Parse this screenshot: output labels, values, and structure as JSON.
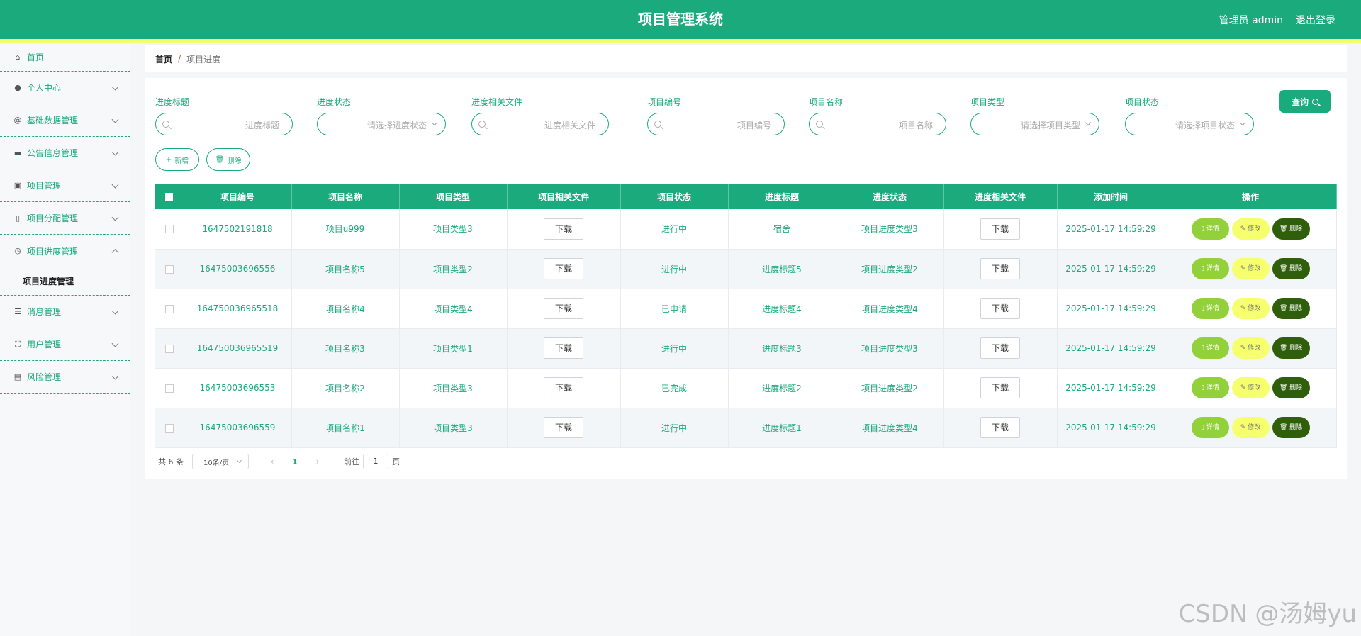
{
  "header": {
    "title": "项目管理系统",
    "user": "管理员 admin",
    "logout": "退出登录",
    "color": "#1baa7c",
    "stripe_color": "#f4ff6b"
  },
  "sidebar": {
    "items": [
      {
        "label": "首页",
        "icon": "home-icon"
      },
      {
        "label": "个人中心",
        "icon": "user-icon"
      },
      {
        "label": "基础数据管理",
        "icon": "at-icon"
      },
      {
        "label": "公告信息管理",
        "icon": "board-icon"
      },
      {
        "label": "项目管理",
        "icon": "briefcase-icon"
      },
      {
        "label": "项目分配管理",
        "icon": "mic-icon"
      },
      {
        "label": "项目进度管理",
        "icon": "clock-icon"
      },
      {
        "label": "消息管理",
        "icon": "list-icon"
      },
      {
        "label": "用户管理",
        "icon": "frame-icon"
      },
      {
        "label": "风险管理",
        "icon": "clipboard-icon"
      }
    ],
    "subitem": "项目进度管理"
  },
  "breadcrumb": {
    "home": "首页",
    "sep": "/",
    "current": "项目进度"
  },
  "filters": [
    {
      "label": "进度标题",
      "placeholder": "进度标题"
    },
    {
      "label": "进度状态",
      "placeholder": "请选择进度状态"
    },
    {
      "label": "进度相关文件",
      "placeholder": "进度相关文件"
    },
    {
      "label": "项目编号",
      "placeholder": "项目编号"
    },
    {
      "label": "项目名称",
      "placeholder": "项目名称"
    },
    {
      "label": "项目类型",
      "placeholder": "请选择项目类型"
    },
    {
      "label": "项目状态",
      "placeholder": "请选择项目状态"
    }
  ],
  "actions": {
    "query": "查询",
    "add": "新增",
    "delete": "删除"
  },
  "table": {
    "headers": [
      "项目编号",
      "项目名称",
      "项目类型",
      "项目相关文件",
      "项目状态",
      "进度标题",
      "进度状态",
      "进度相关文件",
      "添加时间",
      "操作"
    ],
    "download_label": "下载",
    "op_labels": {
      "detail": "详情",
      "edit": "修改",
      "del": "删除"
    },
    "rows": [
      {
        "no": "1647502191818",
        "name": "项目u999",
        "type": "项目类型3",
        "status": "进行中",
        "ptitle": "宿舍",
        "pstatus": "项目进度类型3",
        "time": "2025-01-17 14:59:29"
      },
      {
        "no": "16475003696556",
        "name": "项目名称5",
        "type": "项目类型2",
        "status": "进行中",
        "ptitle": "进度标题5",
        "pstatus": "项目进度类型2",
        "time": "2025-01-17 14:59:29"
      },
      {
        "no": "164750036965518",
        "name": "项目名称4",
        "type": "项目类型4",
        "status": "已申请",
        "ptitle": "进度标题4",
        "pstatus": "项目进度类型4",
        "time": "2025-01-17 14:59:29"
      },
      {
        "no": "164750036965519",
        "name": "项目名称3",
        "type": "项目类型1",
        "status": "进行中",
        "ptitle": "进度标题3",
        "pstatus": "项目进度类型3",
        "time": "2025-01-17 14:59:29"
      },
      {
        "no": "16475003696553",
        "name": "项目名称2",
        "type": "项目类型3",
        "status": "已完成",
        "ptitle": "进度标题2",
        "pstatus": "项目进度类型2",
        "time": "2025-01-17 14:59:29"
      },
      {
        "no": "16475003696559",
        "name": "项目名称1",
        "type": "项目类型3",
        "status": "进行中",
        "ptitle": "进度标题1",
        "pstatus": "项目进度类型4",
        "time": "2025-01-17 14:59:29"
      }
    ]
  },
  "pager": {
    "total": "共 6 条",
    "size": "10条/页",
    "page": "1",
    "goto_prefix": "前往",
    "goto_value": "1",
    "goto_suffix": "页"
  },
  "watermark": "CSDN @汤姆yu"
}
